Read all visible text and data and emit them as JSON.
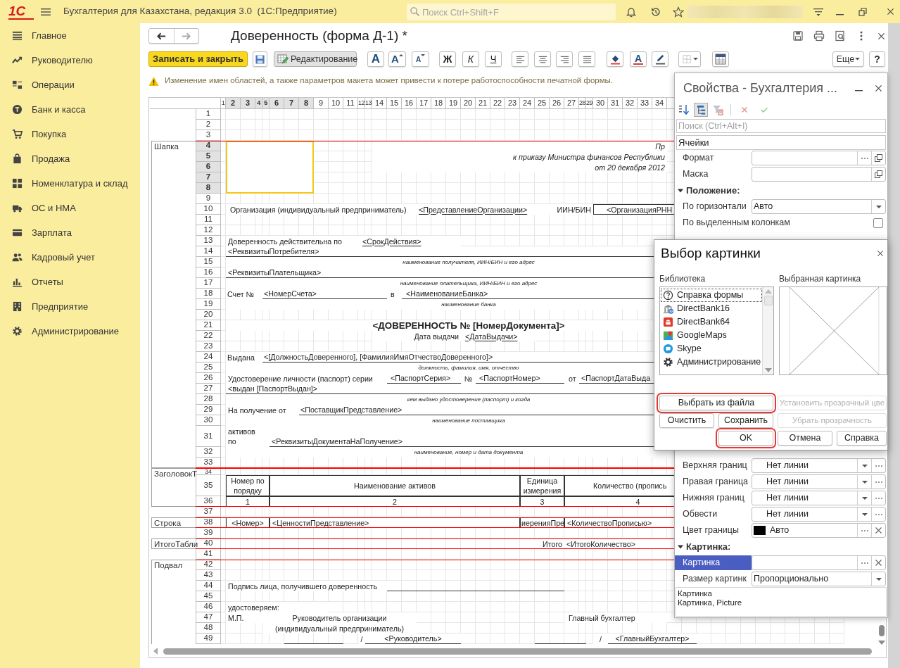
{
  "app": {
    "logo": "1С",
    "title": "Бухгалтерия для Казахстана, редакция 3.0  (1С:Предприятие)",
    "search": {
      "placeholder": "Поиск Ctrl+Shift+F"
    }
  },
  "sidebar": {
    "items": [
      {
        "label": "Главное"
      },
      {
        "label": "Руководителю"
      },
      {
        "label": "Операции"
      },
      {
        "label": "Банк и касса"
      },
      {
        "label": "Покупка"
      },
      {
        "label": "Продажа"
      },
      {
        "label": "Номенклатура и склад"
      },
      {
        "label": "ОС и НМА"
      },
      {
        "label": "Зарплата"
      },
      {
        "label": "Кадровый учет"
      },
      {
        "label": "Отчеты"
      },
      {
        "label": "Предприятие"
      },
      {
        "label": "Администрирование"
      }
    ]
  },
  "document": {
    "title": "Доверенность (форма Д-1) *"
  },
  "toolbar": {
    "save_close": "Записать и закрыть",
    "edit_mode": {
      "label": "Редактирование",
      "pressed": true
    },
    "font_buttons": [
      "A",
      "A",
      "A"
    ],
    "style_buttons": [
      "Ж",
      "К",
      "Ч"
    ],
    "font_color": "A",
    "more": "Еще",
    "help": "?"
  },
  "warning": "Изменение имен областей, а также параметров макета может привести к потере работоспособности печатной формы.",
  "sheet": {
    "columns": [
      {
        "label": "1",
        "selected": false
      },
      {
        "label": "2",
        "selected": true
      },
      {
        "label": "3",
        "selected": true
      },
      {
        "label": "4",
        "selected": true
      },
      {
        "label": "5",
        "selected": true
      },
      {
        "label": "6",
        "selected": true
      },
      {
        "label": "7",
        "selected": true
      },
      {
        "label": "8",
        "selected": true
      },
      {
        "label": "9",
        "selected": false
      },
      {
        "label": "10",
        "selected": false
      },
      {
        "label": "11",
        "selected": false
      },
      {
        "label": "12",
        "selected": false
      },
      {
        "label": "13",
        "selected": false
      },
      {
        "label": "14",
        "selected": false
      },
      {
        "label": "15",
        "selected": false
      },
      {
        "label": "16",
        "selected": false
      },
      {
        "label": "17",
        "selected": false
      },
      {
        "label": "18",
        "selected": false
      },
      {
        "label": "19",
        "selected": false
      },
      {
        "label": "20",
        "selected": false
      },
      {
        "label": "21",
        "selected": false
      },
      {
        "label": "22",
        "selected": false
      },
      {
        "label": "23",
        "selected": false
      },
      {
        "label": "24",
        "selected": false
      },
      {
        "label": "25",
        "selected": false
      },
      {
        "label": "26",
        "selected": false
      },
      {
        "label": "27",
        "selected": false
      },
      {
        "label": "28",
        "selected": false
      },
      {
        "label": "29",
        "selected": false
      },
      {
        "label": "30",
        "selected": false
      },
      {
        "label": "31",
        "selected": false
      },
      {
        "label": "32",
        "selected": false
      },
      {
        "label": "33",
        "selected": false
      },
      {
        "label": "34",
        "selected": false
      }
    ],
    "sections": [
      {
        "rows": [
          {
            "number": "1",
            "selected": false
          },
          {
            "number": "2",
            "selected": false
          },
          {
            "number": "3",
            "selected": false
          }
        ]
      },
      {
        "label": "Шапка",
        "rows": [
          {
            "number": "4",
            "selected": true,
            "cells": [
              {
                "text": "Пр",
                "kind": "italic"
              }
            ]
          },
          {
            "number": "5",
            "selected": true,
            "cells": [
              {
                "text": "к приказу Министра финансов Республики",
                "kind": "italic"
              }
            ]
          },
          {
            "number": "6",
            "selected": true,
            "cells": [
              {
                "text": "от 20 декабря 2012",
                "kind": "italic"
              }
            ]
          },
          {
            "number": "7",
            "selected": true
          },
          {
            "number": "8",
            "selected": true
          },
          {
            "number": "9",
            "selected": false
          },
          {
            "number": "10",
            "selected": false,
            "cells": [
              {
                "text": "Организация (индивидуальный предприниматель)",
                "kind": "text"
              },
              {
                "text": "<ПредставлениеОрганизации>",
                "kind": "text"
              },
              {
                "text": "ИИН/БИН",
                "kind": "text"
              },
              {
                "text": "<ОрганизацияРНН",
                "kind": "text"
              }
            ]
          },
          {
            "number": "11",
            "selected": false
          },
          {
            "number": "12",
            "selected": false
          },
          {
            "number": "13",
            "selected": false,
            "cells": [
              {
                "text": "Доверенность действительна по",
                "kind": "text"
              },
              {
                "text": "<СрокДействия>",
                "kind": "text"
              }
            ]
          },
          {
            "number": "14",
            "selected": false,
            "cells": [
              {
                "text": "<РеквизитыПотребителя>",
                "kind": "text"
              }
            ]
          },
          {
            "number": "15",
            "selected": false,
            "cells": [
              {
                "text": "наименование получателя, ИИН/БИН и его адрес",
                "kind": "caption"
              }
            ]
          },
          {
            "number": "16",
            "selected": false,
            "cells": [
              {
                "text": "<РеквизитыПлательщика>",
                "kind": "text"
              }
            ]
          },
          {
            "number": "17",
            "selected": false,
            "cells": [
              {
                "text": "наименование плательщика, ИИН/БИН и его адрес",
                "kind": "caption"
              }
            ]
          },
          {
            "number": "18",
            "selected": false,
            "cells": [
              {
                "text": "Счет №",
                "kind": "text"
              },
              {
                "text": "<НомерСчета>",
                "kind": "text"
              },
              {
                "text": "в",
                "kind": "text"
              },
              {
                "text": "<НаименованиеБанка>",
                "kind": "text"
              }
            ]
          },
          {
            "number": "19",
            "selected": false,
            "cells": [
              {
                "text": "наименование банка",
                "kind": "caption"
              }
            ]
          },
          {
            "number": "20",
            "selected": false
          },
          {
            "number": "21",
            "selected": false,
            "cells": [
              {
                "text": "<ДОВЕРЕННОСТЬ № [НомерДокумента]>",
                "kind": "title"
              }
            ]
          },
          {
            "number": "22",
            "selected": false,
            "cells": [
              {
                "text": "Дата выдачи",
                "kind": "text"
              },
              {
                "text": "<ДатаВыдачи>",
                "kind": "text"
              }
            ]
          },
          {
            "number": "23",
            "selected": false
          },
          {
            "number": "24",
            "selected": false,
            "cells": [
              {
                "text": "Выдана",
                "kind": "text"
              },
              {
                "text": "<[ДолжностьДоверенного], [ФамилияИмяОтчествоДоверенного]>",
                "kind": "text"
              }
            ]
          },
          {
            "number": "25",
            "selected": false,
            "cells": [
              {
                "text": "должность, фамилия, имя, отчество",
                "kind": "caption"
              }
            ]
          },
          {
            "number": "26",
            "selected": false,
            "cells": [
              {
                "text": "Удостоверение личности (паспорт) серии",
                "kind": "text"
              },
              {
                "text": "<ПаспортСерия>",
                "kind": "text"
              },
              {
                "text": "№",
                "kind": "text"
              },
              {
                "text": "<ПаспортНомер>",
                "kind": "text"
              },
              {
                "text": "от",
                "kind": "text"
              },
              {
                "text": "<ПаспортДатаВыда",
                "kind": "text"
              }
            ]
          },
          {
            "number": "27",
            "selected": false,
            "cells": [
              {
                "text": "<выдан [ПаспортВыдан]>",
                "kind": "text"
              }
            ]
          },
          {
            "number": "28",
            "selected": false,
            "cells": [
              {
                "text": "кем выдано удостоверение (паспорт) и когда",
                "kind": "caption"
              }
            ]
          },
          {
            "number": "29",
            "selected": false,
            "cells": [
              {
                "text": "На получение от",
                "kind": "text"
              },
              {
                "text": "<ПоставщикПредставление>",
                "kind": "text"
              }
            ]
          },
          {
            "number": "30",
            "selected": false,
            "cells": [
              {
                "text": "наименование поставщика",
                "kind": "caption"
              }
            ]
          },
          {
            "number": "31",
            "selected": false,
            "cells": [
              {
                "text": "активов по",
                "kind": "text"
              },
              {
                "text": "<РеквизитыДокументаНаПолучение>",
                "kind": "text"
              }
            ]
          },
          {
            "number": "32",
            "selected": false,
            "cells": [
              {
                "text": "наименование, номер и дата документа",
                "kind": "caption"
              }
            ]
          },
          {
            "number": "33",
            "selected": false
          }
        ]
      },
      {
        "label": "ЗаголовокТ",
        "rows": [
          {
            "number": "34",
            "selected": false
          },
          {
            "number": "35",
            "selected": false,
            "cells": [
              {
                "text": "Номер по порядку",
                "kind": "header"
              },
              {
                "text": "Наименование активов",
                "kind": "header"
              },
              {
                "text": "Единица измерения",
                "kind": "header"
              },
              {
                "text": "Количество (пропись",
                "kind": "header"
              }
            ]
          },
          {
            "number": "36",
            "selected": false,
            "cells": [
              {
                "text": "1",
                "kind": "header"
              },
              {
                "text": "2",
                "kind": "header"
              },
              {
                "text": "3",
                "kind": "header"
              },
              {
                "text": "4",
                "kind": "header"
              }
            ]
          }
        ]
      },
      {
        "rows": [
          {
            "number": "37",
            "selected": false
          }
        ]
      },
      {
        "label": "Строка",
        "rows": [
          {
            "number": "38",
            "selected": false,
            "cells": [
              {
                "text": "<Номер>",
                "kind": "text"
              },
              {
                "text": "<ЦенностиПредставление>",
                "kind": "text"
              },
              {
                "text": "иеренияПре",
                "kind": "text"
              },
              {
                "text": "<КоличествоПрописью>",
                "kind": "text"
              }
            ]
          }
        ]
      },
      {
        "rows": [
          {
            "number": "39",
            "selected": false
          }
        ]
      },
      {
        "label": "ИтогоТабли",
        "rows": [
          {
            "number": "40",
            "selected": false,
            "cells": [
              {
                "text": "Итого",
                "kind": "text"
              },
              {
                "text": "<ИтогоКоличество>",
                "kind": "text"
              }
            ]
          }
        ]
      },
      {
        "rows": [
          {
            "number": "41",
            "selected": false
          }
        ]
      },
      {
        "label": "Подвал",
        "rows": [
          {
            "number": "42",
            "selected": false
          },
          {
            "number": "43",
            "selected": false
          },
          {
            "number": "44",
            "selected": false,
            "cells": [
              {
                "text": "Подпись лица, получившего доверенность",
                "kind": "text"
              }
            ]
          },
          {
            "number": "45",
            "selected": false
          },
          {
            "number": "46",
            "selected": false,
            "cells": [
              {
                "text": "удостоверяем:",
                "kind": "text"
              }
            ]
          },
          {
            "number": "47",
            "selected": false,
            "cells": [
              {
                "text": "М.П.",
                "kind": "text"
              },
              {
                "text": "Руководитель организации",
                "kind": "text"
              },
              {
                "text": "Главный бухгалтер",
                "kind": "text"
              }
            ]
          },
          {
            "number": "48",
            "selected": false,
            "cells": [
              {
                "text": "(индивидуальный предприниматель)",
                "kind": "text"
              }
            ]
          },
          {
            "number": "49",
            "selected": false,
            "cells": [
              {
                "text": "/",
                "kind": "text"
              },
              {
                "text": "<Руководитель>",
                "kind": "text"
              },
              {
                "text": "/",
                "kind": "text"
              },
              {
                "text": "<ГлавныйБухгалтер>",
                "kind": "text"
              }
            ]
          }
        ]
      }
    ]
  },
  "properties": {
    "title": "Свойства - Бухгалтерия ...",
    "search": {
      "placeholder": "Поиск (Ctrl+Alt+I)"
    },
    "object": "Ячейки",
    "rows": [
      {
        "kind": "field",
        "label": "Формат",
        "selected": false,
        "choice": true,
        "open": true
      },
      {
        "kind": "field",
        "label": "Маска",
        "selected": false,
        "open": true
      },
      {
        "kind": "group",
        "label": "Положение:",
        "selected": false,
        "expanded": true
      },
      {
        "kind": "field",
        "label": "По горизонтали",
        "selected": false,
        "value": "Авто",
        "dropdown": true
      },
      {
        "kind": "check",
        "label": "По выделенным колонкам",
        "selected": false,
        "checked": false
      }
    ],
    "rows_below_dialog": [
      {
        "kind": "field",
        "label": "Верхняя границ",
        "selected": false,
        "value": "Нет линии",
        "dropdown": true,
        "choice": true
      },
      {
        "kind": "field",
        "label": "Правая граница",
        "selected": false,
        "value": "Нет линии",
        "dropdown": true,
        "choice": true
      },
      {
        "kind": "field",
        "label": "Нижняя границ",
        "selected": false,
        "value": "Нет линии",
        "dropdown": true,
        "choice": true
      },
      {
        "kind": "field",
        "label": "Обвести",
        "selected": false,
        "value": "Нет линии",
        "dropdown": true,
        "choice": true
      },
      {
        "kind": "color",
        "label": "Цвет границы",
        "selected": false,
        "value": "Авто",
        "color": "#000000",
        "choice": true,
        "clear": true
      },
      {
        "kind": "group",
        "label": "Картинка:",
        "selected": false,
        "expanded": true
      },
      {
        "kind": "field",
        "label": "Картинка",
        "selected": true,
        "choice": true,
        "clear": true
      },
      {
        "kind": "field",
        "label": "Размер картинк",
        "selected": false,
        "value": "Пропорционально",
        "dropdown": true
      }
    ],
    "description": [
      "Картинка",
      "Картинка, Picture"
    ]
  },
  "dialog": {
    "title": "Выбор картинки",
    "library_label": "Библиотека",
    "preview_label": "Выбранная картинка",
    "library": [
      {
        "label": "Справка формы",
        "selected": true
      },
      {
        "label": "DirectBank16",
        "selected": false
      },
      {
        "label": "DirectBank64",
        "selected": false
      },
      {
        "label": "GoogleMaps",
        "selected": false
      },
      {
        "label": "Skype",
        "selected": false
      },
      {
        "label": "Администрирование",
        "selected": false
      }
    ],
    "buttons": [
      {
        "label": "Выбрать из файла",
        "disabled": false,
        "highlighted": true
      },
      {
        "label": "Установить прозрачный цве",
        "disabled": true,
        "highlighted": false
      },
      {
        "label": "Очистить",
        "disabled": false,
        "highlighted": false
      },
      {
        "label": "Сохранить",
        "disabled": false,
        "highlighted": false
      },
      {
        "label": "Убрать прозрачность",
        "disabled": true,
        "highlighted": false
      },
      {
        "label": "OK",
        "disabled": false,
        "highlighted": true
      },
      {
        "label": "Отмена",
        "disabled": false,
        "highlighted": false
      },
      {
        "label": "Справка",
        "disabled": false,
        "highlighted": false
      }
    ]
  }
}
